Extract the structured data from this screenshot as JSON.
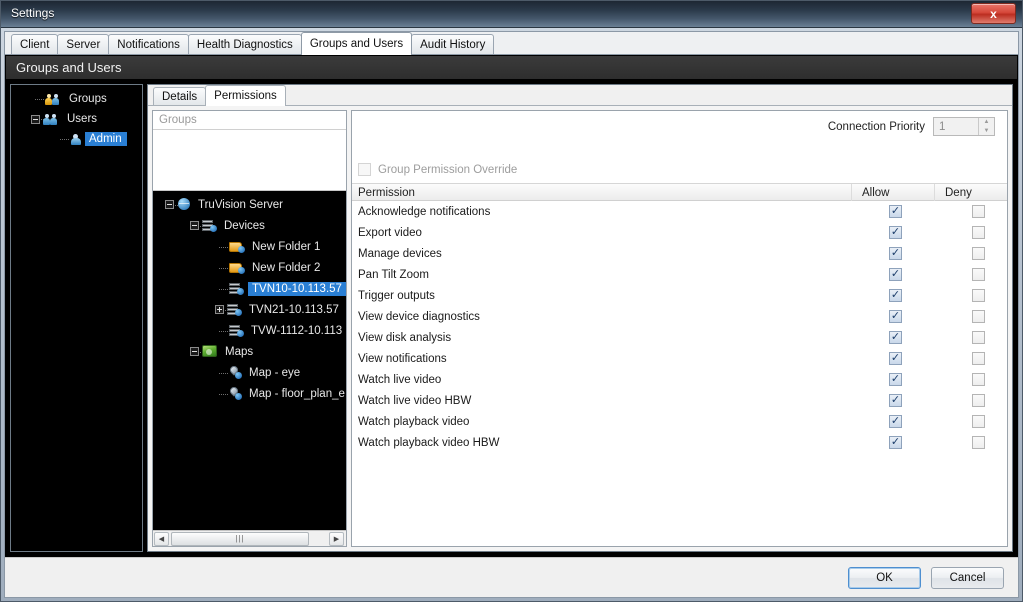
{
  "window": {
    "title": "Settings",
    "close_label": "x"
  },
  "tabs": [
    {
      "label": "Client",
      "active": false
    },
    {
      "label": "Server",
      "active": false
    },
    {
      "label": "Notifications",
      "active": false
    },
    {
      "label": "Health Diagnostics",
      "active": false
    },
    {
      "label": "Groups and Users",
      "active": true
    },
    {
      "label": "Audit History",
      "active": false
    }
  ],
  "section": {
    "title": "Groups and Users"
  },
  "left_tree": {
    "items": [
      {
        "label": "Groups",
        "icon": "people-gold-icon",
        "indent": 0,
        "expander": "none"
      },
      {
        "label": "Users",
        "icon": "people-blue-icon",
        "indent": 0,
        "expander": "minus"
      },
      {
        "label": "Admin",
        "icon": "user-icon",
        "indent": 1,
        "expander": "none",
        "selected": true
      }
    ]
  },
  "subtabs": [
    {
      "label": "Details",
      "active": false
    },
    {
      "label": "Permissions",
      "active": true
    }
  ],
  "groups_box": {
    "header": "Groups",
    "items": []
  },
  "device_tree": {
    "items": [
      {
        "label": "TruVision Server",
        "icon": "globe-icon",
        "indent": 0,
        "expander": "minus"
      },
      {
        "label": "Devices",
        "icon": "server-icon",
        "indent": 1,
        "expander": "minus"
      },
      {
        "label": "New Folder 1",
        "icon": "folder-icon",
        "indent": 2,
        "expander": "none"
      },
      {
        "label": "New Folder 2",
        "icon": "folder-icon",
        "indent": 2,
        "expander": "none"
      },
      {
        "label": "TVN10-10.113.57",
        "icon": "server-icon",
        "indent": 2,
        "expander": "none",
        "selected": true
      },
      {
        "label": "TVN21-10.113.57",
        "icon": "server-icon",
        "indent": 2,
        "expander": "plus"
      },
      {
        "label": "TVW-1112-10.113",
        "icon": "server-icon",
        "indent": 2,
        "expander": "none"
      },
      {
        "label": "Maps",
        "icon": "map-icon",
        "indent": 1,
        "expander": "minus"
      },
      {
        "label": "Map - eye",
        "icon": "pin-icon",
        "indent": 2,
        "expander": "none"
      },
      {
        "label": "Map - floor_plan_e",
        "icon": "pin-icon",
        "indent": 2,
        "expander": "none"
      }
    ]
  },
  "scrollbar": {
    "left_arrow": "◀",
    "right_arrow": "▶",
    "grip": "|||"
  },
  "connection_priority": {
    "label": "Connection Priority",
    "value": "1",
    "up_arrow": "▲",
    "down_arrow": "▼"
  },
  "group_permission_override": {
    "label": "Group Permission Override",
    "checked": false,
    "disabled": true
  },
  "permissions_grid": {
    "columns": [
      "Permission",
      "Allow",
      "Deny"
    ],
    "rows": [
      {
        "name": "Acknowledge notifications",
        "allow": true,
        "deny": false
      },
      {
        "name": "Export video",
        "allow": true,
        "deny": false
      },
      {
        "name": "Manage devices",
        "allow": true,
        "deny": false
      },
      {
        "name": "Pan Tilt Zoom",
        "allow": true,
        "deny": false
      },
      {
        "name": "Trigger outputs",
        "allow": true,
        "deny": false
      },
      {
        "name": "View device diagnostics",
        "allow": true,
        "deny": false
      },
      {
        "name": "View disk analysis",
        "allow": true,
        "deny": false
      },
      {
        "name": "View notifications",
        "allow": true,
        "deny": false
      },
      {
        "name": "Watch live video",
        "allow": true,
        "deny": false
      },
      {
        "name": "Watch live video HBW",
        "allow": true,
        "deny": false
      },
      {
        "name": "Watch playback video",
        "allow": true,
        "deny": false
      },
      {
        "name": "Watch playback video HBW",
        "allow": true,
        "deny": false
      }
    ]
  },
  "buttons": {
    "ok": "OK",
    "cancel": "Cancel"
  },
  "colors": {
    "selection": "#2a7fd4",
    "close_button": "#d6483a",
    "header_band": "#3b3b3b"
  }
}
